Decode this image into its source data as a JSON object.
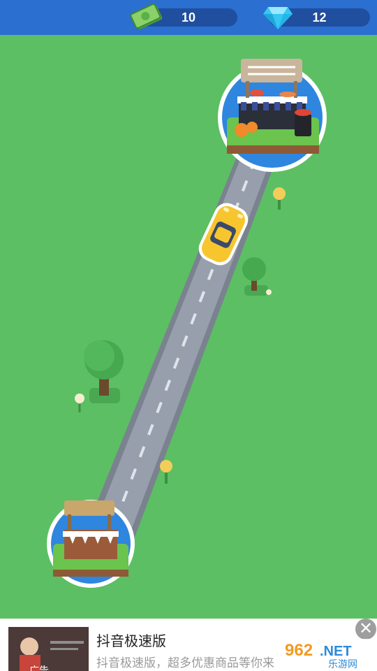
{
  "hud": {
    "money": {
      "icon": "cash-bills-icon",
      "value": "10"
    },
    "gems": {
      "icon": "diamond-icon",
      "value": "12"
    }
  },
  "scene": {
    "road": "diagonal-road",
    "player_vehicle": "yellow-sports-car",
    "destination_shop": "seafood-market-stall",
    "origin_shop": "wooden-market-stall"
  },
  "ad": {
    "title": "抖音极速版",
    "subtitle": "抖音极速版，超多优惠商品等你来",
    "tag": "广告",
    "close_icon": "close-icon",
    "watermark": "962.NET 乐游网"
  },
  "colors": {
    "grass": "#5cbf63",
    "topbar": "#2b6fd0",
    "road": "#8e96a3",
    "car": "#f7c62f"
  }
}
